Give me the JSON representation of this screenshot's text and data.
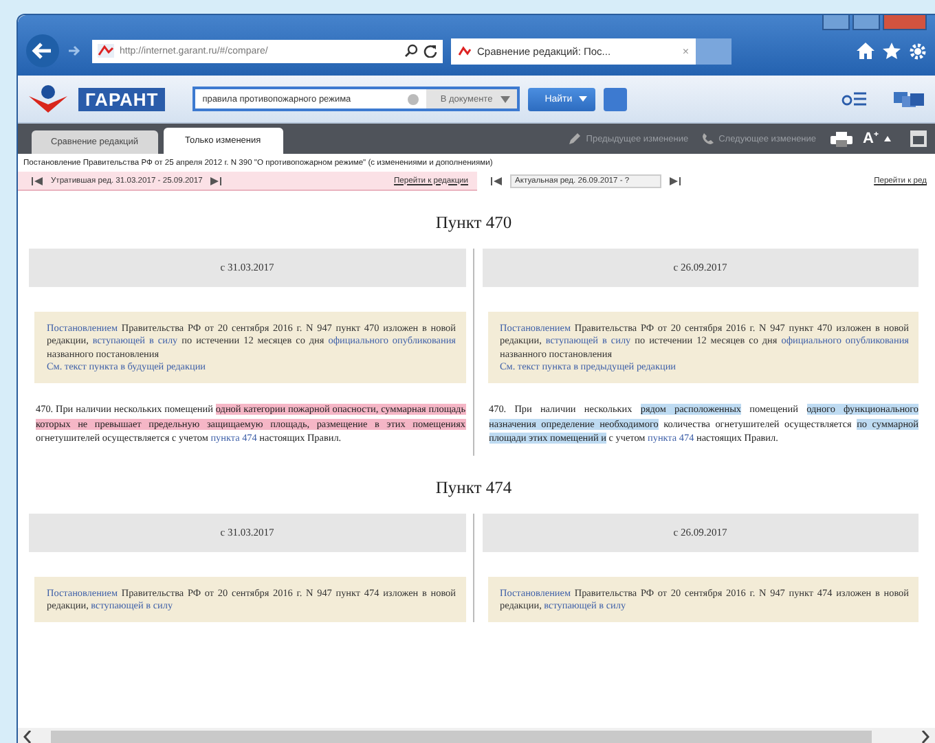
{
  "browser": {
    "address": "http://internet.garant.ru/#/compare/",
    "tab_title": "Сравнение редакций: Пос...",
    "tab_close": "×"
  },
  "app_toolbar": {
    "logo_text": "ГАРАНТ",
    "search": {
      "value": "правила противопожарного режима"
    },
    "scope": "В документе",
    "search_button": "Найти"
  },
  "tabs": [
    {
      "label": "Сравнение редакций",
      "selected": false
    },
    {
      "label": "Только изменения",
      "selected": true
    }
  ],
  "tools": [
    {
      "label": "Предыдущее изменение"
    },
    {
      "label": "Следующее изменение"
    }
  ],
  "font_size_label": "A$^{+}$",
  "document_title": "Постановление Правительства РФ от 25 апреля 2012 г. N 390 \"О противопожарном режиме\" (с изменениями и дополнениями)",
  "editions": [
    {
      "kind": "old",
      "label": "Утратившая ред. 31.03.2017 - 25.09.2017",
      "link": "Перейти к редакции"
    },
    {
      "kind": "current",
      "label": "Актуальная ред. 26.09.2017 - ?",
      "link": "Перейти к ред"
    }
  ],
  "sections": [
    {
      "title": "Пункт 470",
      "columns": [
        {
          "date": "с 31.03.2017",
          "note": [
            {
              "kind": "link",
              "text": "Постановлением"
            },
            {
              "kind": "plain",
              "text": " Правительства РФ от 20 сентября 2016 г. N 947 пункт 470 изложен в новой редакции, "
            },
            {
              "kind": "link",
              "text": "вступающей в силу"
            },
            {
              "kind": "plain",
              "text": " по истечении 12 месяцев со дня "
            },
            {
              "kind": "link",
              "text": "официального опубликования"
            },
            {
              "kind": "plain",
              "text": " названного постановления"
            }
          ],
          "see_also": "См. текст пункта в будущей редакции",
          "paragraph": [
            {
              "kind": "plain",
              "text": "470. При наличии нескольких помещений "
            },
            {
              "kind": "deleted",
              "text": "одной категории пожарной опасности, суммарная площадь которых не превышает предельную защищаемую площадь, размещение в этих помещениях"
            },
            {
              "kind": "plain",
              "text": " огнетушителей осуществляется с учетом "
            },
            {
              "kind": "link",
              "text": "пункта 474"
            },
            {
              "kind": "plain",
              "text": " настоящих Правил."
            }
          ]
        },
        {
          "date": "с 26.09.2017",
          "note": [
            {
              "kind": "link",
              "text": "Постановлением"
            },
            {
              "kind": "plain",
              "text": " Правительства РФ от 20 сентября 2016 г. N 947 пункт 470 изложен в новой редакции, "
            },
            {
              "kind": "link",
              "text": "вступающей в силу"
            },
            {
              "kind": "plain",
              "text": " по истечении 12 месяцев со дня "
            },
            {
              "kind": "link",
              "text": "официального опубликования"
            },
            {
              "kind": "plain",
              "text": " названного постановления"
            }
          ],
          "see_also": "См. текст пункта в предыдущей редакции",
          "paragraph": [
            {
              "kind": "plain",
              "text": "470. При наличии нескольких "
            },
            {
              "kind": "added",
              "text": "рядом расположенных"
            },
            {
              "kind": "plain",
              "text": " помещений "
            },
            {
              "kind": "added",
              "text": "одного функционального назначения определение необходимого"
            },
            {
              "kind": "plain",
              "text": " количества огнетушителей осуществляется "
            },
            {
              "kind": "added",
              "text": "по суммарной площади этих помещений и"
            },
            {
              "kind": "plain",
              "text": " с учетом "
            },
            {
              "kind": "link",
              "text": "пункта 474"
            },
            {
              "kind": "plain",
              "text": " настоящих Правил."
            }
          ]
        }
      ]
    },
    {
      "title": "Пункт 474",
      "columns": [
        {
          "date": "с 31.03.2017",
          "note": [
            {
              "kind": "link",
              "text": "Постановлением"
            },
            {
              "kind": "plain",
              "text": " Правительства РФ от 20 сентября 2016 г. N 947 пункт 474 изложен в новой редакции, "
            },
            {
              "kind": "link",
              "text": "вступающей в силу"
            }
          ]
        },
        {
          "date": "с 26.09.2017",
          "note": [
            {
              "kind": "link",
              "text": "Постановлением"
            },
            {
              "kind": "plain",
              "text": " Правительства РФ от 20 сентября 2016 г. N 947 пункт 474 изложен в новой редакции, "
            },
            {
              "kind": "link",
              "text": "вступающей в силу"
            }
          ]
        }
      ]
    }
  ]
}
